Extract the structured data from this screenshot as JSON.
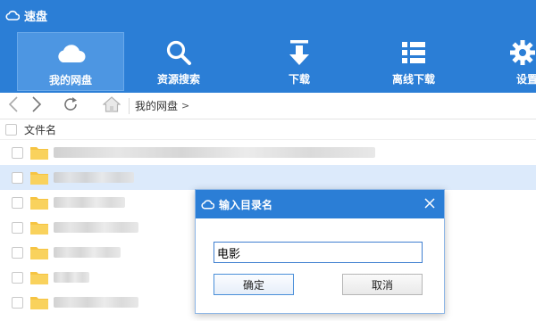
{
  "app": {
    "title": "速盘",
    "icon": "cloud-icon"
  },
  "toolbar": {
    "items": [
      {
        "label": "我的网盘",
        "icon": "cloud-icon",
        "active": true
      },
      {
        "label": "资源搜索",
        "icon": "search-icon",
        "active": false
      },
      {
        "label": "下载",
        "icon": "download-icon",
        "active": false
      },
      {
        "label": "离线下载",
        "icon": "list-icon",
        "active": false
      },
      {
        "label": "设置",
        "icon": "gear-icon",
        "active": false
      }
    ]
  },
  "navbar": {
    "back_icon": "chevron-left-icon",
    "forward_icon": "chevron-right-icon",
    "refresh_icon": "refresh-icon",
    "home_icon": "home-icon",
    "breadcrumb": "我的网盘",
    "breadcrumb_arrow": ">"
  },
  "filelist": {
    "column_header": "文件名",
    "rows": [
      {
        "selected": false,
        "name_redacted": true
      },
      {
        "selected": true,
        "name_redacted": true
      },
      {
        "selected": false,
        "name_redacted": true
      },
      {
        "selected": false,
        "name_redacted": true
      },
      {
        "selected": false,
        "name_redacted": true
      },
      {
        "selected": false,
        "name_redacted": true
      },
      {
        "selected": false,
        "name_redacted": true
      }
    ]
  },
  "dialog": {
    "title": "输入目录名",
    "icon": "cloud-icon",
    "close_icon": "close-icon",
    "input_value": "电影",
    "ok_label": "确定",
    "cancel_label": "取消"
  },
  "colors": {
    "header_blue": "#2b7ed6",
    "active_tab": "#4d96e2",
    "selected_row": "#dceafb",
    "folder_yellow": "#f6c443"
  }
}
